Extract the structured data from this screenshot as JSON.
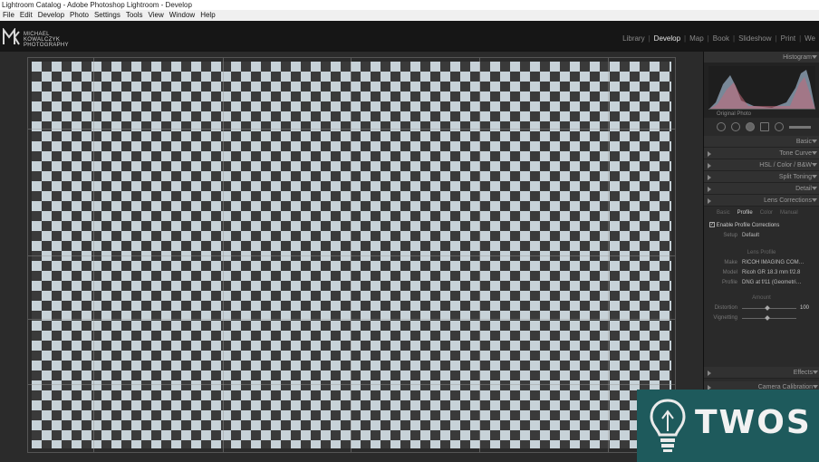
{
  "window": {
    "title": "Lightroom Catalog - Adobe Photoshop Lightroom - Develop"
  },
  "menu": [
    "File",
    "Edit",
    "Develop",
    "Photo",
    "Settings",
    "Tools",
    "View",
    "Window",
    "Help"
  ],
  "identity_plate": {
    "text": "MICHAEL KOWALCZYK PHOTOGRAPHY"
  },
  "modules": [
    "Library",
    "Develop",
    "Map",
    "Book",
    "Slideshow",
    "Print",
    "We"
  ],
  "active_module": "Develop",
  "panel": {
    "histogram": "Histogram",
    "original_photo": "Original Photo",
    "sections": {
      "basic": "Basic",
      "tone_curve": "Tone Curve",
      "hsl": "HSL / Color / B&W",
      "split_toning": "Split Toning",
      "detail": "Detail",
      "lens_corrections": "Lens Corrections",
      "effects": "Effects",
      "camera_calibration": "Camera Calibration"
    },
    "lens_tabs": [
      "Basic",
      "Profile",
      "Color",
      "Manual"
    ],
    "active_lens_tab": "Profile",
    "enable_profile": "Enable Profile Corrections",
    "setup_label": "Setup",
    "setup_value": "Default",
    "lens_profile_label": "Lens Profile",
    "make_label": "Make",
    "make_value": "RICOH IMAGING COM…",
    "model_label": "Model",
    "model_value": "Ricoh GR 18.3 mm f/2.8",
    "profile_label": "Profile",
    "profile_value": "DNG at f/11 (Geometri…",
    "amount_label": "Amount",
    "distortion_label": "Distortion",
    "distortion_value": "100",
    "vignetting_label": "Vignetting"
  },
  "watermark": {
    "text": "TWOS"
  }
}
